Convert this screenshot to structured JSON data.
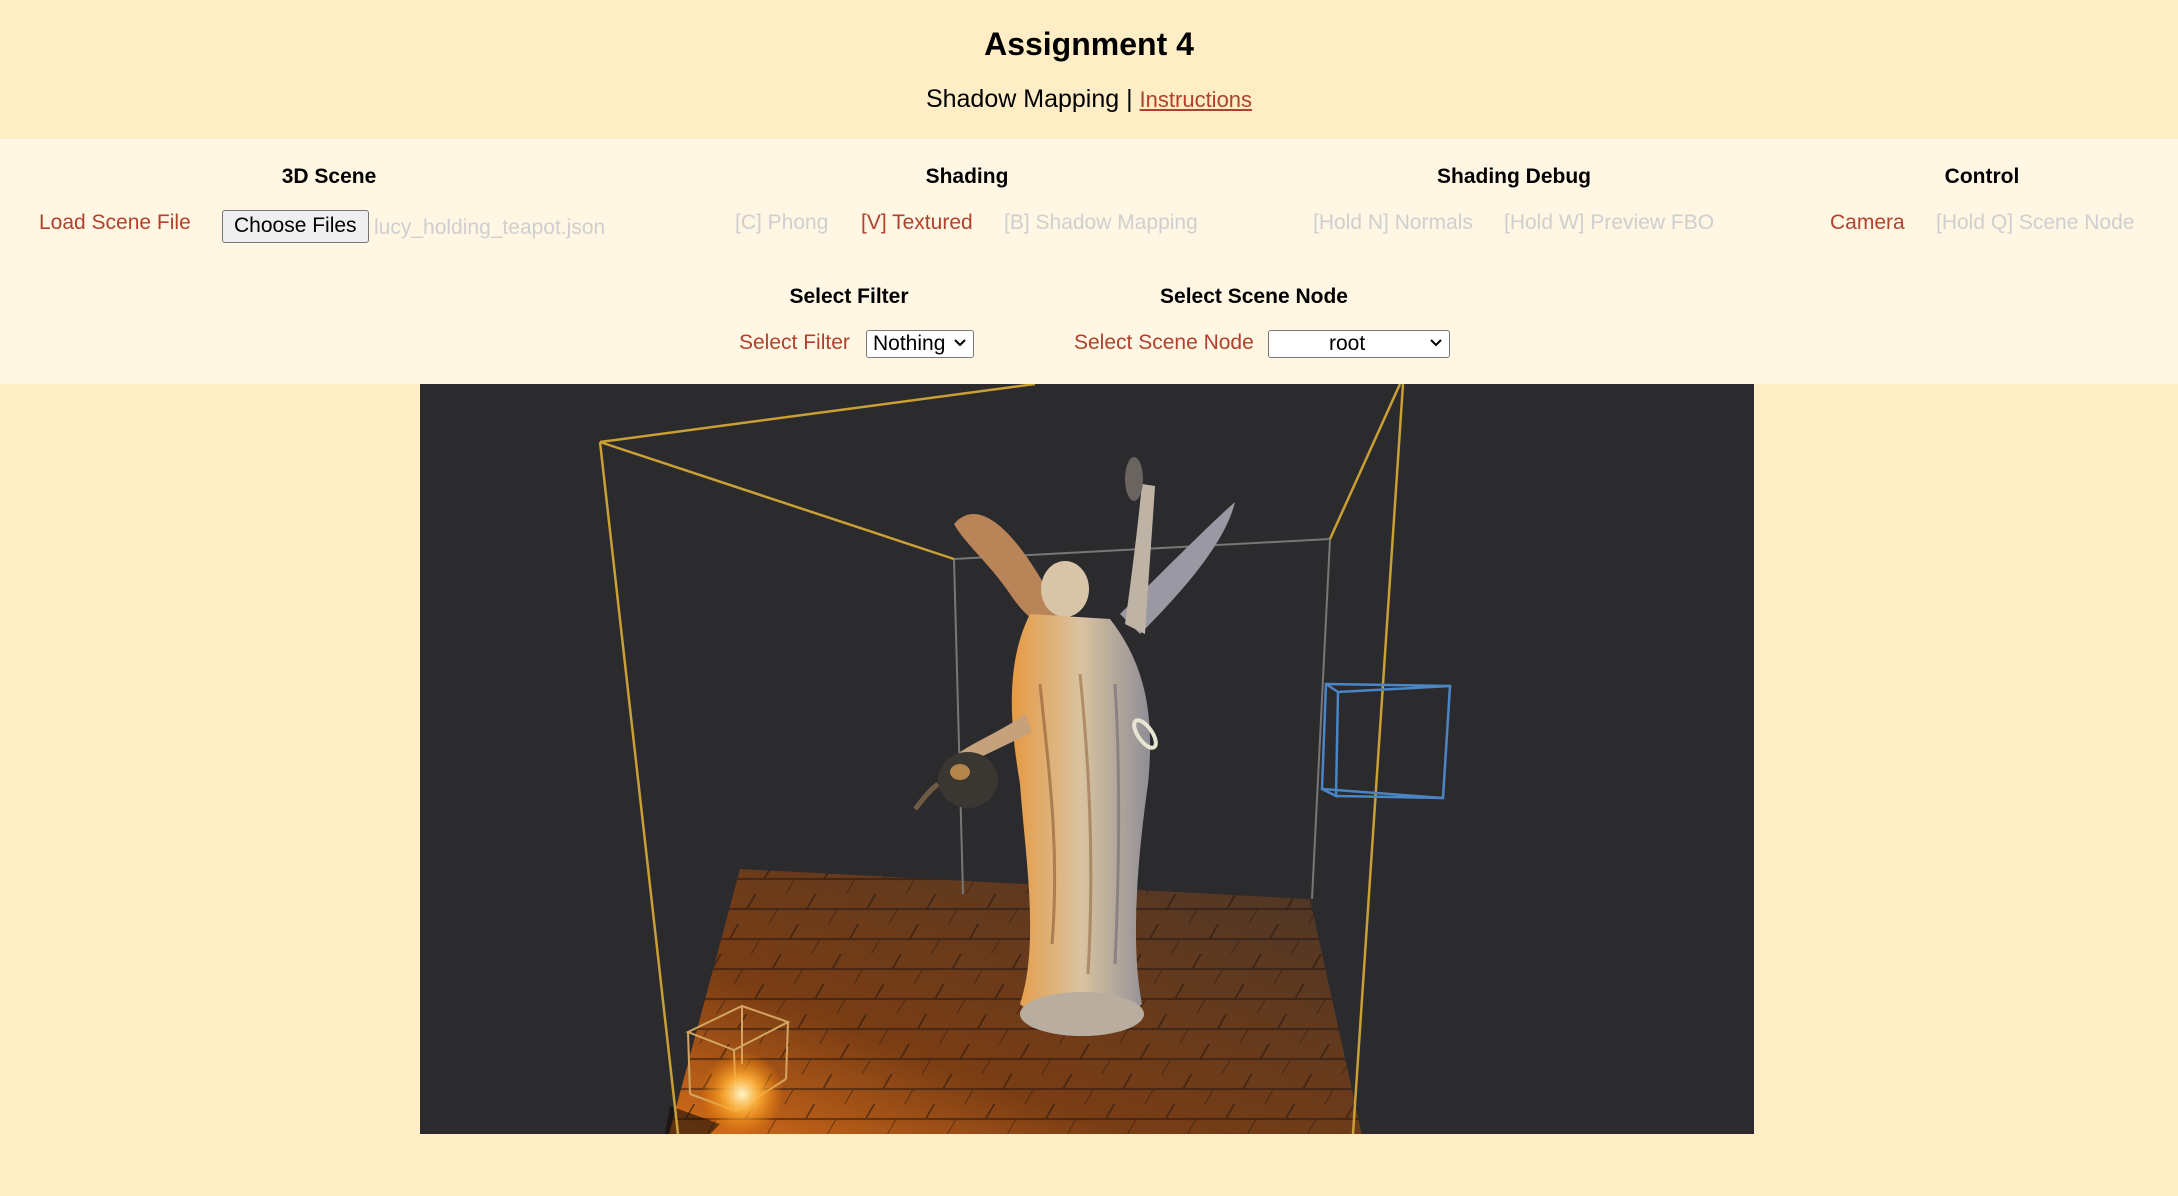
{
  "header": {
    "title": "Assignment 4",
    "subtitle_text": "Shadow Mapping |",
    "instructions_link": "Instructions"
  },
  "controls": {
    "scene": {
      "heading": "3D Scene",
      "load_label": "Load Scene File",
      "choose_button": "Choose Files",
      "file_name": "lucy_holding_teapot.json"
    },
    "shading": {
      "heading": "Shading",
      "phong": "[C] Phong",
      "textured": "[V] Textured",
      "shadow_mapping": "[B] Shadow Mapping"
    },
    "shading_debug": {
      "heading": "Shading Debug",
      "normals": "[Hold N] Normals",
      "preview_fbo": "[Hold W] Preview FBO"
    },
    "control": {
      "heading": "Control",
      "camera": "Camera",
      "scene_node": "[Hold Q] Scene Node"
    },
    "filter": {
      "heading": "Select Filter",
      "label": "Select Filter",
      "value": "Nothing"
    },
    "scene_node": {
      "heading": "Select Scene Node",
      "label": "Select Scene Node",
      "value": "root"
    }
  },
  "colors": {
    "accent": "#b2412c",
    "disabled": "#cfcfcf",
    "page_bg": "#ffedc5",
    "panel_bg": "#fff6e4",
    "viewport_bg": "#2b2a2c",
    "light_bbox": "#c9a036",
    "selected_bbox": "#4a86c6"
  },
  "icons": {
    "chevron": "chevron-down-icon"
  }
}
